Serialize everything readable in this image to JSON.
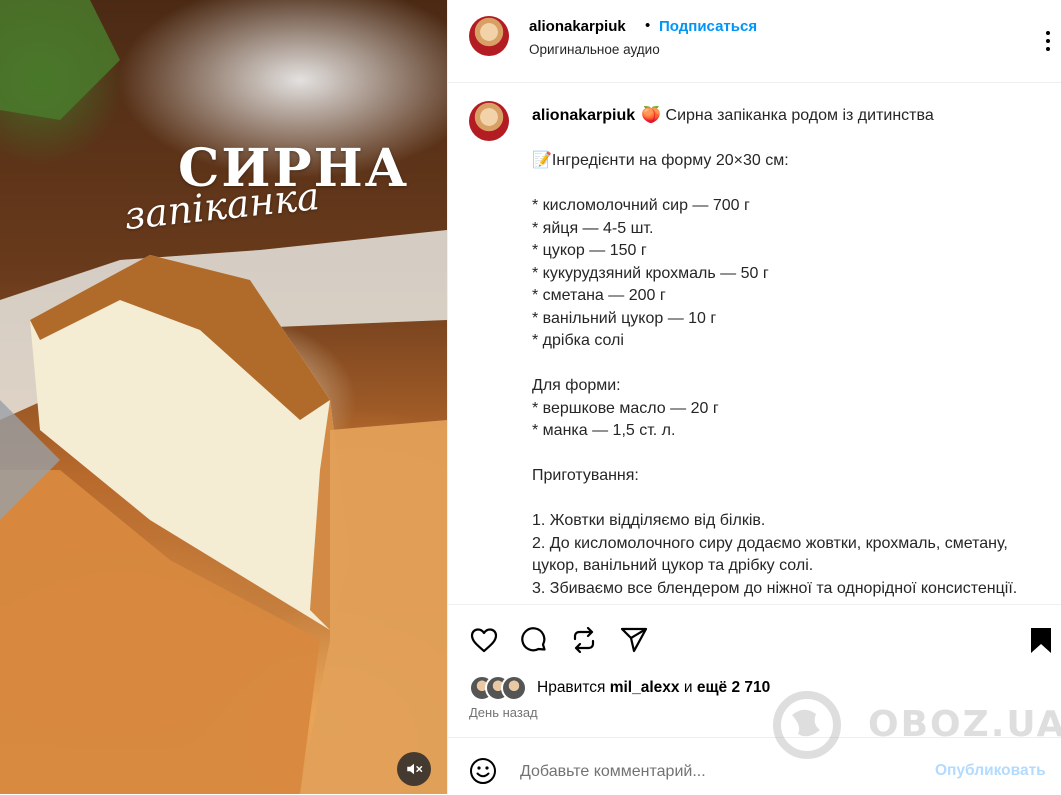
{
  "media": {
    "title_line1": "СИРНА",
    "title_line2": "запіканка",
    "mute_icon": "speaker-muted-icon"
  },
  "header": {
    "username": "alionakarpiuk",
    "separator": "•",
    "follow_label": "Подписаться",
    "audio_label": "Оригинальное аудио",
    "more_icon": "more-options-icon"
  },
  "caption": {
    "username": "alionakarpiuk",
    "lines": [
      "🍑 Сирна запіканка родом із дитинства",
      "",
      "📝Інгредієнти на форму 20×30 см:",
      "",
      "* кисломолочний сир — 700 г",
      "* яйця — 4-5 шт.",
      "* цукор — 150 г",
      "* кукурудзяний крохмаль — 50 г",
      "* сметана — 200 г",
      "* ванільний цукор — 10 г",
      "* дрібка солі",
      "",
      "Для форми:",
      "* вершкове масло — 20 г",
      "* манка — 1,5 ст. л.",
      "",
      "Приготування:",
      "",
      "1. Жовтки відділяємо від білків.",
      "2. До кисломолочного сиру додаємо жовтки, крохмаль, сметану, цукор, ванільний цукор та дрібку солі.",
      "3. Збиваємо все блендером до ніжної та однорідної консистенції."
    ]
  },
  "actions": {
    "icons": [
      "heart-icon",
      "comment-icon",
      "share-icon",
      "send-icon",
      "bookmark-icon"
    ]
  },
  "likes": {
    "prefix": "Нравится",
    "user": "mil_alexx",
    "middle": "и",
    "rest": "ещё 2 710"
  },
  "date": "День назад",
  "comment": {
    "placeholder": "Добавьте комментарий...",
    "publish_label": "Опубликовать",
    "emoji_icon": "smiley-icon"
  },
  "watermark": {
    "text": "OBOZ.UA"
  },
  "colors": {
    "accent": "#0095f6",
    "publish_disabled": "#b3dbff",
    "muted_text": "#737373",
    "border": "#efefef"
  }
}
